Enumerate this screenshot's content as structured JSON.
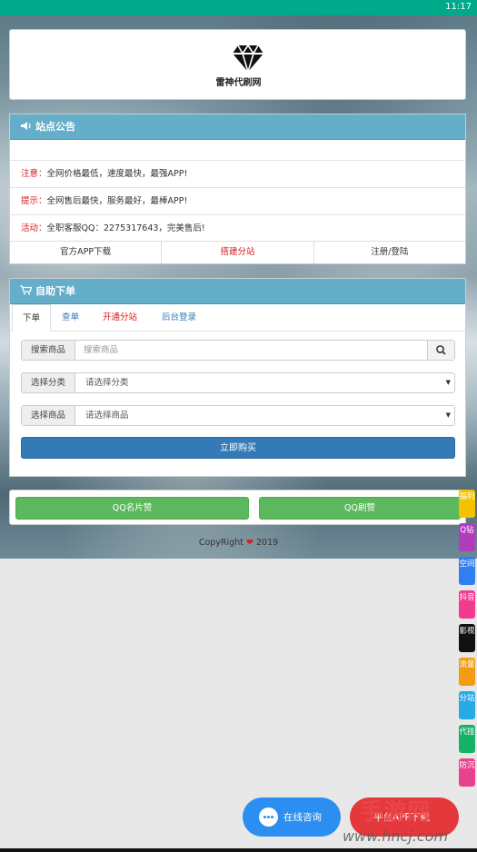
{
  "status_bar": {
    "time": "11:17"
  },
  "logo": {
    "text": "雷神代刷网"
  },
  "notice": {
    "title": "站点公告",
    "rows": [
      {
        "key": "注意：",
        "text": "全网价格最低，速度最快，最强APP!"
      },
      {
        "key": "提示：",
        "text": "全网售后最快，服务最好，最棒APP!"
      },
      {
        "key": "活动：",
        "text": "全职客服QQ：2275317643，完美售后!"
      }
    ],
    "links": [
      {
        "label": "官方APP下载",
        "color": "#333333"
      },
      {
        "label": "搭建分站",
        "color": "#d9191c"
      },
      {
        "label": "注册/登陆",
        "color": "#333333"
      }
    ]
  },
  "order": {
    "title": "自助下单",
    "tabs": [
      {
        "label": "下单",
        "color": "#333333"
      },
      {
        "label": "查单",
        "color": "#337ab7"
      },
      {
        "label": "开通分站",
        "color": "#d9191c"
      },
      {
        "label": "后台登录",
        "color": "#337ab7"
      }
    ],
    "search": {
      "label": "搜索商品",
      "placeholder": "搜索商品"
    },
    "category": {
      "label": "选择分类",
      "value": "请选择分类"
    },
    "product": {
      "label": "选择商品",
      "value": "请选择商品"
    },
    "buy_label": "立即购买"
  },
  "likes": {
    "left": "QQ名片赞",
    "right": "QQ刷赞"
  },
  "copyright": {
    "prefix": "CopyRight",
    "year": "2019"
  },
  "side_tabs": [
    {
      "label": "福利",
      "color": "#f5c200"
    },
    {
      "label": "Q钻",
      "color": "#b03dbb"
    },
    {
      "label": "空间",
      "color": "#2f7ff0"
    },
    {
      "label": "抖音",
      "color": "#f03b8e"
    },
    {
      "label": "影视",
      "color": "#111111"
    },
    {
      "label": "流量",
      "color": "#f39c12"
    },
    {
      "label": "分站",
      "color": "#29a9e6"
    },
    {
      "label": "代挂",
      "color": "#16b26a"
    },
    {
      "label": "防沉",
      "color": "#e8418e"
    }
  ],
  "chat": {
    "label": "在线咨询"
  },
  "download": {
    "label": "平台APP下载"
  },
  "watermark": {
    "title": "手游网",
    "url": "www.hncj.com"
  }
}
